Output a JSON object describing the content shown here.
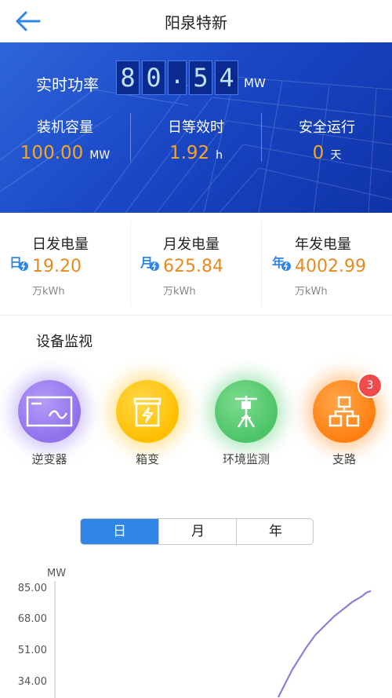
{
  "header": {
    "title": "阳泉特新",
    "back_icon": "arrow-left-icon",
    "accent": "#2f86e6"
  },
  "hero": {
    "realtime_label": "实时功率",
    "realtime_digits": [
      "8",
      "0",
      ".",
      "5",
      "4"
    ],
    "realtime_unit": "MW",
    "stats": [
      {
        "label": "装机容量",
        "value": "100.00",
        "unit": "MW"
      },
      {
        "label": "日等效时",
        "value": "1.92",
        "unit": "h"
      },
      {
        "label": "安全运行",
        "value": "0",
        "unit": "天"
      }
    ],
    "value_color": "#f5a623"
  },
  "generation": [
    {
      "title": "日发电量",
      "icon": "day-energy-icon",
      "icon_char": "日",
      "value": "19.20",
      "unit": "万kWh"
    },
    {
      "title": "月发电量",
      "icon": "month-energy-icon",
      "icon_char": "月",
      "value": "625.84",
      "unit": "万kWh"
    },
    {
      "title": "年发电量",
      "icon": "year-energy-icon",
      "icon_char": "年",
      "value": "4002.99",
      "unit": "万kWh"
    }
  ],
  "devices": {
    "title": "设备监视",
    "items": [
      {
        "label": "逆变器",
        "icon": "inverter-icon",
        "color": "#9b7ef0"
      },
      {
        "label": "箱变",
        "icon": "box-transformer-icon",
        "color": "#ffc21a"
      },
      {
        "label": "环境监测",
        "icon": "weather-station-icon",
        "color": "#56cc73"
      },
      {
        "label": "支路",
        "icon": "branch-network-icon",
        "color": "#ff8a1e",
        "badge": "3"
      }
    ]
  },
  "period_tabs": {
    "items": [
      "日",
      "月",
      "年"
    ],
    "active": "日"
  },
  "chart_data": {
    "type": "line",
    "ylabel": "MW",
    "y_ticks": [
      "85.00",
      "68.00",
      "51.00",
      "34.00"
    ],
    "ylim": [
      20,
      90
    ],
    "x": [
      0.0,
      0.05,
      0.1,
      0.15,
      0.2,
      0.3,
      0.4,
      0.5,
      0.6,
      0.7,
      0.8,
      0.9,
      0.95,
      1.0
    ],
    "series": [
      {
        "values": [
          25,
          30,
          35,
          40,
          44,
          52,
          59,
          64,
          69,
          73,
          77,
          80,
          82,
          83
        ],
        "color": "#8a7fd6"
      }
    ]
  }
}
